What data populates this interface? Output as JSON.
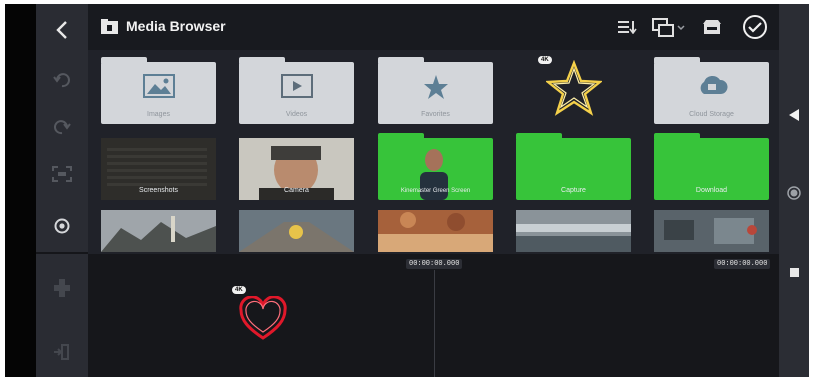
{
  "header": {
    "title": "Media Browser",
    "icons": [
      "folder-info-icon",
      "sort-icon",
      "layout-toggle-icon",
      "store-icon",
      "checkmark-circle-icon"
    ]
  },
  "left_rail": {
    "icons": [
      "back-arrow-icon",
      "undo-icon",
      "redo-icon",
      "fullscreen-icon",
      "settings-icon",
      "layer-icon",
      "exit-icon"
    ]
  },
  "right_rail": {
    "icons": [
      "play-icon",
      "record-icon",
      "stop-icon"
    ]
  },
  "folders": [
    {
      "label": "Images",
      "icon": "image-icon"
    },
    {
      "label": "Videos",
      "icon": "video-icon"
    },
    {
      "label": "Favorites",
      "icon": "star-icon"
    },
    {
      "label": "4K",
      "icon": "star-sticker-icon"
    },
    {
      "label": "Cloud Storage",
      "icon": "cloud-icon"
    }
  ],
  "media_row": [
    {
      "label": "Screenshots"
    },
    {
      "label": "Camera"
    },
    {
      "label": "Kinemaster Green Screen"
    },
    {
      "label": "Capture"
    },
    {
      "label": "Download"
    }
  ],
  "timeline": {
    "timecode_left": "00:00:00.000",
    "timecode_right": "00:00:00.000",
    "clip_badge": "4K"
  },
  "colors": {
    "frame_bg": "#202229",
    "header_bg": "#181a1f",
    "folder_gray": "#d3d6da",
    "green_screen": "#37c43a",
    "timeline_bg": "#16171b",
    "heart_red": "#e0182a"
  }
}
